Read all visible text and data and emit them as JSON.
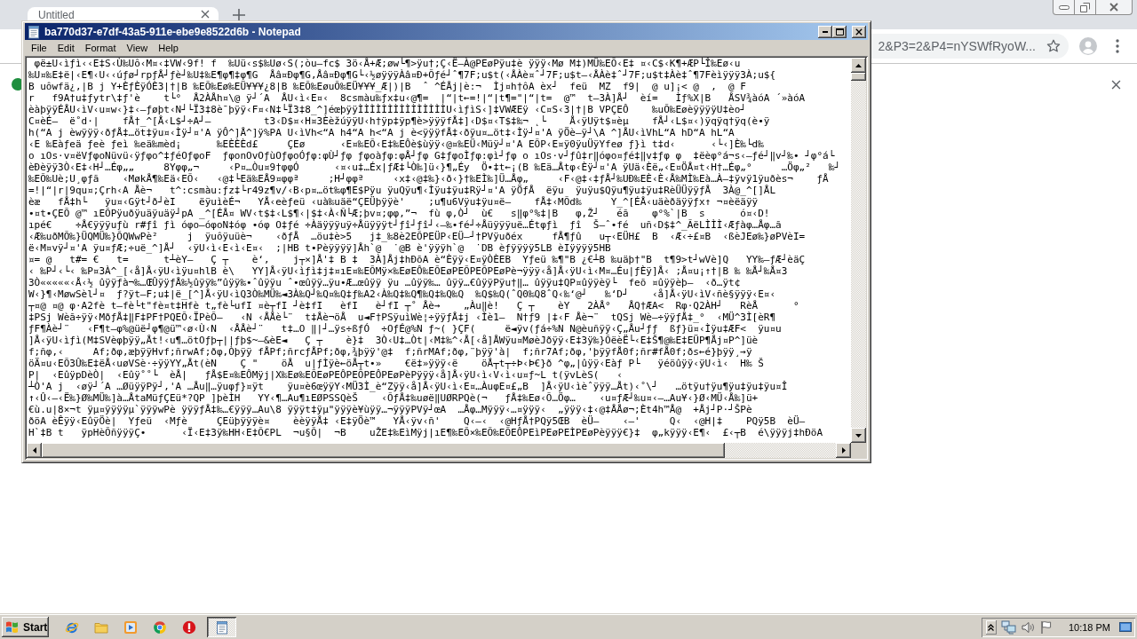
{
  "browser": {
    "tabs": [
      {
        "title": "Untitled",
        "selected": true
      }
    ],
    "address": "2&P3=2&P4=nYSWfRyoW..."
  },
  "notepad": {
    "title": "ba770d37-e7df-43a5-911e-ebe9e8522d6b - Notepad",
    "menu": [
      "File",
      "Edit",
      "Format",
      "View",
      "Help"
    ],
    "lines": [
      " φë±U‹ìƒì‹‹E‡S‹Ù‰Uô‹M¤‹‡VW‹9f! f  ‰Uü‹s$‰Uø‹S(;òu–fc$ 3ö‹Å+Æ;øw└¶>ÿu†;Ç‹Ë–À@PEøPÿu‡è ÿÿÿ‹Mø M‡)MÜ‰EÕ‹E‡ ¤‹C$‹K¶+ÆP└Î‰Eø‹u",
      "‰U¤‰E‡ë|‹E¶‹U‹‹úƒø┘rpƒÅ┘ƒè┘‰U‡‰E¶φ¶‡φ¶G  Åâ¤Đφ¶G,Åâ¤Đφ¶G└‹½øÿÿÿÀâ¤Đ+Õƒé┘ˆ¶7F;u$t(‹ÅÀè¤ˆ┘7F;u$t–‹ÅÀè‡ˆ┘7F;u$t‡Àè‡ˆ¶7Fèìÿÿÿ3À;u${",
      "B uôwfä¿,|B j Y+ÈƒÈÿÓÈ3|†|B ‰EÕ‰Eø‰EÜ¥¥¥¿8|B ‰EÕ‰EøuÕ‰EÜ¥¥¥_Æ|)|B  ˆ ^ÉÅj|è:¬  Ìj¤h†ôA èx┘  feü  MZ  f9|  @ u]¡< @  ,  @ F",
      "r   f9A†u‡ƒytr\\‡ƒ'è    t└°  Å2ÀÅh¤\\@ ÿ┘´A  ÅU‹ì‹E¤‹  8csmàu‰ƒx‡u‹@¶=  |“|t←=!|“|t¶=\"|“|t=  @™  t–3À]Å┘  èí=   Ìƒ%X|B   ÅSV¾àóA ´»àóA",
      "èàþÿÿÉÅU‹ìV‹u¤w‹}‡‹–ƒøþt‹N┘└Ï3‡8è¯þÿÿ‹F¤‹N‡└Ï3‡8_^]éœþÿÿÌÌÌÌÌÌÌÌÌÌÌÌÌÌÌU‹ìƒìS‹]‡VWÆEÿ ‹C¤S‹3|†|B VPÇEÔ    ‰uÕ‰EøèÿÿÿÿU‡èo┘",
      "C¤èÉ–  ë˚d·|    fÅ†_^[Å‹L$┘÷A┘–         t3‹D$¤‹H¤3ÈèžúÿÿU‹h†ÿp‡ÿp¶è>ÿÿÿfÅ‡]‹D$¤‹T$‡‰¬ ˛└    Å‹ÿUÿt$¤èµ    fÅ┘‹L$¤‹)ÿqÿq†ÿq(è•ÿ",
      "h(“A j èwÿÿÿ‹ðƒÅ‡…öt‡ÿu¤‹Ìÿ┘¤'A ÿÔ^]Å^]ÿ%PA U‹ìVh<“A h4“A h<“A j è<ÿÿÿfÅ‡‹ðÿu¤…öt‡‹Ìÿ┘¤'A ÿÖè–ÿ┘\\A ^]ÅU‹ìVhL“A hD“A hL“A",
      "‹E ‰Eàƒeä ƒeè ƒeì ‰eä‰mèd¡      ‰EÈÈÈd£     ÇEø      ‹E¤‰EÕ‹E‡‰EÔè$ùÿÿ‹@¤‰EÜ‹Müÿ┘¤'A EÕP‹E¤ÿ0ÿuÜÿYfeø ƒ}ì t‡d‹      ‹└‹]È‰└d‰",
      "o ıOs·v¤ëVƒφoNüvü‹ÿƒφo^‡ƒéOƒφoF  ƒφonOvOƒùOƒφoÓƒφ:φÙ┘ƒφ ƒφoàƒφ:φÅ┘ƒφ G‡ƒφoÌƒφ:φì┘ƒφ o ıOs·v┘ƒû‡r‖óφo¤ƒé‡‖v‡ƒφ φ  ‡ëèφ°á¬s‹–ƒé┘‖v┘‰• ┘φ°á└",
      "èĐèÿÿ3Ò‹E‡‹H┘…Éφ„„     8Yφφ„¬     ‹P¤…Òu¤9†φφÓ      ‹¤‹u‡…Éx|ƒÆ‡└Ò‰]ü‹}¶„Éy  Ö•‡t←¡(B ‰Eä…Åtφ‹Èÿ┘¤'A ÿUä‹Èë„‹E¤ÖÅ¤t‹H†…Éφ„°     …Öφ„²   ‰┘",
      "‰EÕ‰Uè;U¸φƒã    ‹MøkÅ¶‰Eä‹EÕ‹   ‹@‡└Eä‰EÅ9¤φφª     ;H┘φφª     ‹x‡‹@‡‰}‹ð‹}†‰EÌ‰]Ü…Åφ„     ‹F‹@‡‹‡ƒÅ┘‰UÐ‰EÈ‹È‹Å‰MÌ‰Eà…À–‡ÿvÿ1ÿuðès¬    ƒÅ",
      "=!|“|r|9qu¤;Çrh‹A Åè¬   t^:csmàu:ƒz‡└r49z¶v/‹B‹p¤…öt‰φ¶E$Pÿu ÿuQÿu¶‹Ìÿu‡ÿu‡Rÿ┘¤'A ÿÖƒÅ  ëÿu  ÿuÿu$Qÿu¶ÿu‡ÿu‡RèÜÜÿÿƒÅ  3À@_^[]ÅL",
      "èæ   fÅ‡h└   ÿu¤‹Gÿt┘ð┘èI    ëÿuìèÉ¬   YÅ‹eèƒeü ‹uà‰uäë“ÇEÜþÿÿè'    ;u¶u6Vÿu‡ÿu¤ë–    fÅ‡‹MÕd‰     Y_^[ÉÅ‹uäèðäÿÿƒx↑ ¬¤èëäÿÿ",
      "•¤t•ÇEÕ @™ ıEÕPÿuðÿuäÿuäÿ┘pA _^[ÉÅ¤ WV‹t$‡‹L$¶‹|$‡‹À‹Ñ└Æ;þv¤;φφ,”¬  fù φ,Ò┘  ù€   s‖φ°%‡|B   φ,Ž┘   éã    φ°%`|B  s      ó¤‹D!",
      "ıpé€    ÷Å€ÿÿÿuƒù r#ƒî ƒì óφo–óφoN‡óφ •óφ O‡ƒé ÷Àäÿÿÿuÿ÷Åüÿÿÿt┘ƒî┘ƒî┘‹–‰•fé┘÷Åüÿÿÿuë…Étφƒì  ƒî  Š–ˆ•fé  uñ‹D$‡^_ÃëLÌÌÌ‹Æƒàφ…Åφ…ã",
      "‹Æ‰uðMÕ‰}ÜQMÜ‰}ÕQWwPè²     j  ÿuôÿuüè¬    ‹ðƒÅ  …öu‡è>5   j‡_‰8è2EÕPEÜP‹EÜ–┘†PVÿuðéx     fÅ¶ƒû   u┬‹EÜH£  B  ‹Æ‹÷£¤B  ‹ßèJEø‰}øPVèI=",
      "ë‹M¤vÿ┘¤'A ÿu¤ƒÆ;÷uë_^]Å┘  ‹ÿU‹ì‹E‹ì‹E¤‹  ;|HB t•Pèÿÿÿÿ]Åh`@  ˙@B è'ÿÿÿh`@  ˙DB èƒÿÿÿÿ5LB èIÿÿÿÿ5HB",
      "¤= @   t#= €   t=      t┴èY–   Ç ┬    è‘,    j┬×]Å'‡ B ‡  3À]Åj‡hÐõA è“Èÿÿ‹E¤ÿÒÈEB  Yƒeü ‰¶\"B ¿€┴B ‰uäþ†\"B  t¶9>t┘wVè]Q   YY‰–ƒÆ┘èäÇ",
      "‹ ‰P┘‹└‹ ‰P¤3À^_[‹å]Å‹ÿU‹ìÿu¤hlB è\\   YY]Å‹ÿU‹ìƒì‡j‡¤ıE¤‰EÕMÿ×‰EøEÔ‰EÕEøPEÕPEÕPEøPè¬ÿÿÿ‹å]Å‹ÿU‹ì‹M¤…Éu|ƒÈÿ]Å‹ ;Å¤u¡↑†|B ‰ ‰Å┘‰Å¤3",
      "3Ò«««««‹Å‹½ ûÿÿƒà¬‰…ŒÛÿÿƒÅ‰½ûÿÿ‰”ûÿÿ‰•ˆûÿÿu ˆ•œûÿÿ…ÿu•Æ…œûÿÿ ÿu …ûÿÿ‰… ûÿÿ…€ûÿÿPÿu†‖… ûÿÿu‡QP¤ûÿÿèÿ└  feõ ¤ûÿÿèþ–  ‹ð…ÿt¢",
      "W‹}¶‹MøwSèl┘¤  ƒ?ÿt–F;u‡|ë_[^]Å‹ÿU‹ìQ3Ò‰MÜ‰◄3À‰Q┘‰Q¤‰Q‡ƒ‰A2‹À‰Q‡‰Q¶‰Q‡‰Q‰Q  ‰Q$‰Q(ˆQ0‰Q8ˆQ‹‰‘@┘   ‰‘D┘    ‹å]Å‹ÿU‹ìV‹ñè§ÿÿÿ‹E¤‹",
      "┬¤@ ¤@ φ·A2fè t–fè└t\"fè¤t‡Hfè t„fè└ufI ¤è┬fI ┘è‡fI   èfI   è┘fI ┬˚ Åè→    „Àu‖è!   Ç ┬    èY   2ÀÅ°   ÅQ†ÆA<  Rφ·Q2ÀH┘   RèÅ      °",
      "‡PSj Wèã÷ÿÿ‹MðƒÅ‡‖F‡PF†PQEÕ‹ÏPèÕ–   ‹N ‹ÅÅè└¨  t‡Åè¬öÅ  u◄F†PSÿuìWè¦÷ÿÿƒÅ‡j ‹Ìè1–  N†ƒ9 |‡‹F Åè¬¨  tQSj Wè–÷ÿÿƒÅ‡_°  ‹MÜ^3Ì[èR¶",
      "ƒF¶Àè┘¨   ‹F¶t–φ%@üë┘φ¶@ü™‹ø‹Ù‹N  ‹ÅÅè┘¨   t‡…O ‖|┘…ÿs÷ßƒÓ  ÷OƒÉ@%N ƒ~( }ÇF(     ë◄ÿv(ƒá÷%N N@èuñÿÿ‹Ç„Åu┘ƒƒ  ßƒ}ü¤‹Ìÿu‡ÆF<  ÿu¤u",
      "]Å‹ÿU‹ìƒì(M‡SVèφþÿÿ„Åt!‹u¶…ötOƒþ┬||ƒþ$~–&èE◄   Ç ┬    è}‡  3Ò‹U‡…Òt|‹M‡‰^‹Å[‹å]ÅWÿu¤MøèJðÿÿ‹E‡3ÿ‰}ÕëèË└‹E‡Š¶@‰E‡EÜP¶Åj¤P^]üè",
      "f;ñφ,‹     Af;ðφ,æþÿÿHvf;ñrwAf;ðφ,Òþÿÿ fÅPf;ñrcƒÅPf;ðφ,¾þÿÿ'@‡  f;ñrMAf;ðφ,¨þÿÿ'à|  f;ñr7Af;ðφ,'þÿÿfÅ0f;ñr#fÅ0f;ðs←é}þÿÿ¸→ÿ",
      "öÄ¤u‹EÕ3Û‰E‡ëÅ‹uøVSè·÷ÿÿYY„Åt(èN    Ç \"    öÅ  u|ƒÌÿè←öÅ┬t•»    €ë‡»ÿÿÿ‹ë    öÅ┬t┬÷Þ‹Þ€}ð ^φ„|ûÿÿ‹Eàƒ P└   ÿéöûÿÿ‹ÿU‹ì‹  H‰ Š",
      "P|  ‹EûÿpDèÒ|  ‹Eûÿ˚˚└  èÅ|   ƒÅ$E¤‰EÔMÿj|X‰Eø‰EÕEøPEÔPEÕPEÔPEøPèPÿÿÿ‹å]Å‹ÿU‹ì‹V‹ì‹u¤ƒ~L t(ÿvLèS(   ‹",
      "┴Ò'A j  ‹øÿ┘´A …ØüÿÿPÿ┘,'A …Åu‖…ÿuφƒ}¤ÿt    ÿu¤è6œÿÿY‹MÜ3Ì_è“Zÿÿ‹å]Å‹ÿU‹ì‹E¤…ÀuφE¤£„B  ]Å‹ÿU‹ìèˆÿÿÿ…Åt)‹˚\\┘   …ötÿu†ÿu¶ÿu‡ÿu‡ÿu¤Î",
      "↑‹Û‹–‹Ë‰}Ø‰MÜ‰]à…ÅtaMüƒÇEü*?QP ]þèÌH   YY‹¶…Au¶ıEØPSSQèŠ    ‹ÕƒÅ‡‰uøë‖UØRPQè(¬   ƒÅ‡‰Eø‹Õ…Öφ…    ‹u¤ƒÆ┘‰u¤‹–…Au¥‹}Ø‹MÜ‹Å‰]ü+",
      "€ù.u|8×¬t ÿµ¤ÿÿÿÿµ`ÿÿÿwPè ÿÿÿƒÅ‡‰…€ÿÿÿ…Au\\8 ÿÿÿt‡ÿµ\"ÿÿÿè¥ùÿÿ…¬ÿÿÿPVÿ┘œA  …Åφ…Mÿÿÿ‹…¤ÿÿÿ‹  „ÿÿÿ‹‡‹@‡ÅÅø¬;Èt4h™Å@  +Åj┘P·┘ŠPè",
      "ðöA èÊÿÿ‹EûÿÖè|  Yƒeü  ‹Mƒè     ÇEüþÿÿÿè¤    èèÿÿÅ‡ ‹E‡ÿÖè™   YÅ‹ÿv‹ñ'    Q‹–‹  ‹@HƒÅ†PQÿ5ŒB  èÜ–    ‹–'     Q‹  ‹@H|‡    PQÿ5B  èÜ–",
      "H`‡B t   ÿpHèÕñÿÿÿÇ•      ‹Ï‹E‡3ÿ‰HH‹E‡Õ€PL  ¬u§Õ|  ¬B    uŽE‡‰EìMÿj|ıE¶‰EÕ×‰EÕ‰EÕEÔPEìPEøPEÌPEøPèÿÿÿ€}‡  φ„kÿÿÿ‹E¶‹  £‹┬B  é\\ÿÿÿj‡hÐöA"
    ]
  },
  "taskbar": {
    "start": "Start",
    "pinned": [
      {
        "kind": "orbit"
      },
      {
        "kind": "folder"
      },
      {
        "kind": "media"
      },
      {
        "kind": "wheel"
      },
      {
        "kind": "alert"
      }
    ],
    "windows": [
      {
        "kind": "notepad",
        "selected": true
      }
    ],
    "clock": "10:18 PM"
  }
}
